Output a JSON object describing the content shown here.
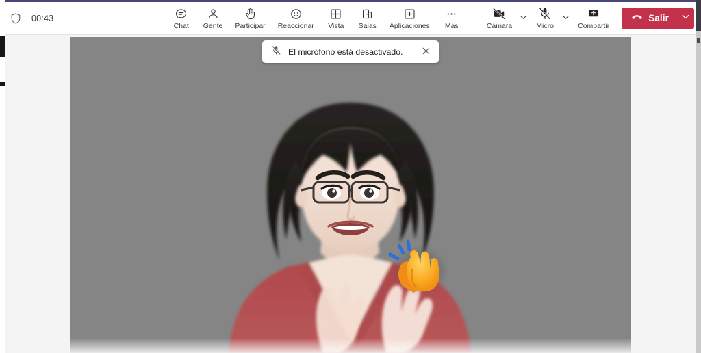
{
  "meeting": {
    "timer": "00:43",
    "shield_icon": "shield-icon"
  },
  "toolbar": {
    "items": [
      {
        "label": "Chat",
        "icon": "chat-icon"
      },
      {
        "label": "Gente",
        "icon": "people-icon"
      },
      {
        "label": "Participar",
        "icon": "raise-hand-icon"
      },
      {
        "label": "Reaccionar",
        "icon": "smiley-reaction-icon"
      },
      {
        "label": "Vista",
        "icon": "grid-view-icon"
      },
      {
        "label": "Salas",
        "icon": "breakout-rooms-icon"
      },
      {
        "label": "Aplicaciones",
        "icon": "apps-plus-icon"
      },
      {
        "label": "Más",
        "icon": "more-ellipsis-icon"
      }
    ],
    "media": [
      {
        "label": "Cámara",
        "icon": "camera-off-icon",
        "state": "off"
      },
      {
        "label": "Micro",
        "icon": "microphone-off-icon",
        "state": "off"
      },
      {
        "label": "Compartir",
        "icon": "share-screen-icon",
        "state": "on"
      }
    ],
    "hangup": {
      "label": "Salir",
      "icon": "hangup-phone-icon",
      "chevron_icon": "chevron-down-icon",
      "color": "#c4314b"
    },
    "chevron_icon": "chevron-down-icon"
  },
  "toast": {
    "icon": "microphone-off-icon",
    "message": "El micrófono está desactivado.",
    "close_icon": "close-x-icon"
  },
  "stage": {
    "video_background": "#858585",
    "avatar": {
      "description": "avatar-video-tile",
      "hair_color": "#1d1b1a",
      "skin_color": "#f0ddd2",
      "shirt_color": "#b5484c",
      "reaction_emoji": "clapping-hands-emoji",
      "reaction_color": "#f9a825"
    }
  },
  "theme": {
    "accent": "#464775",
    "hangup_red": "#c4314b",
    "toolbar_bg": "#ffffff",
    "stage_bg": "#f4f4f4"
  }
}
